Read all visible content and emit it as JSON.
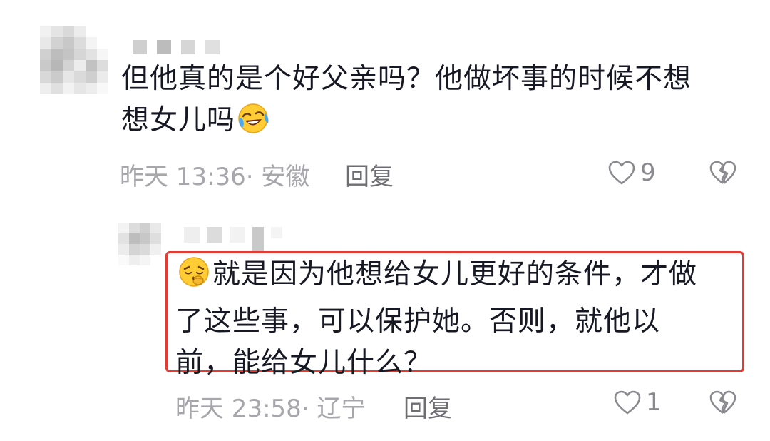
{
  "comments": [
    {
      "text_line1": "但他真的是个好父亲吗？他做坏事的时候不想",
      "text_line2": "想女儿吗",
      "time": "昨天 13:36· 安徽",
      "reply_label": "回复",
      "like_count": "9",
      "emoji_icon": "laughing-tears-icon"
    },
    {
      "text_line1": "就是因为他想给女儿更好的条件，才做",
      "text_line2": "了这些事，可以保护她。否则，就他以",
      "text_line3": "前，能给女儿什么？",
      "time": "昨天 23:58· 辽宁",
      "reply_label": "回复",
      "like_count": "1",
      "emoji_icon": "pensive-face-icon"
    }
  ],
  "colors": {
    "text": "#161823",
    "meta": "#a6a6ab",
    "highlight": "#e53935"
  }
}
